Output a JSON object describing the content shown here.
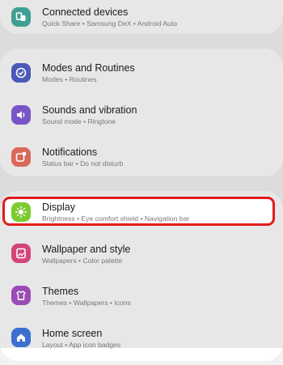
{
  "settings": {
    "items": [
      {
        "title": "Connected devices",
        "subtitle": "Quick Share  •  Samsung DeX  •  Android Auto",
        "icon": "connected-devices-icon",
        "color": "#3f9f92"
      },
      {
        "title": "Modes and Routines",
        "subtitle": "Modes  •  Routines",
        "icon": "check-circle-icon",
        "color": "#4a58b8"
      },
      {
        "title": "Sounds and vibration",
        "subtitle": "Sound mode  •  Ringtone",
        "icon": "speaker-icon",
        "color": "#7a55c7"
      },
      {
        "title": "Notifications",
        "subtitle": "Status bar  •  Do not disturb",
        "icon": "notification-icon",
        "color": "#d9695a"
      },
      {
        "title": "Display",
        "subtitle": "Brightness  •  Eye comfort shield  •  Navigation bar",
        "icon": "sun-icon",
        "color": "#7ccb2f"
      },
      {
        "title": "Wallpaper and style",
        "subtitle": "Wallpapers  •  Color palette",
        "icon": "wallpaper-icon",
        "color": "#d4447a"
      },
      {
        "title": "Themes",
        "subtitle": "Themes  •  Wallpapers  •  Icons",
        "icon": "themes-icon",
        "color": "#9b4bb5"
      },
      {
        "title": "Home screen",
        "subtitle": "Layout  •  App icon badges",
        "icon": "home-icon",
        "color": "#3d6fd0"
      }
    ]
  },
  "highlight_color": "#e01b1b"
}
